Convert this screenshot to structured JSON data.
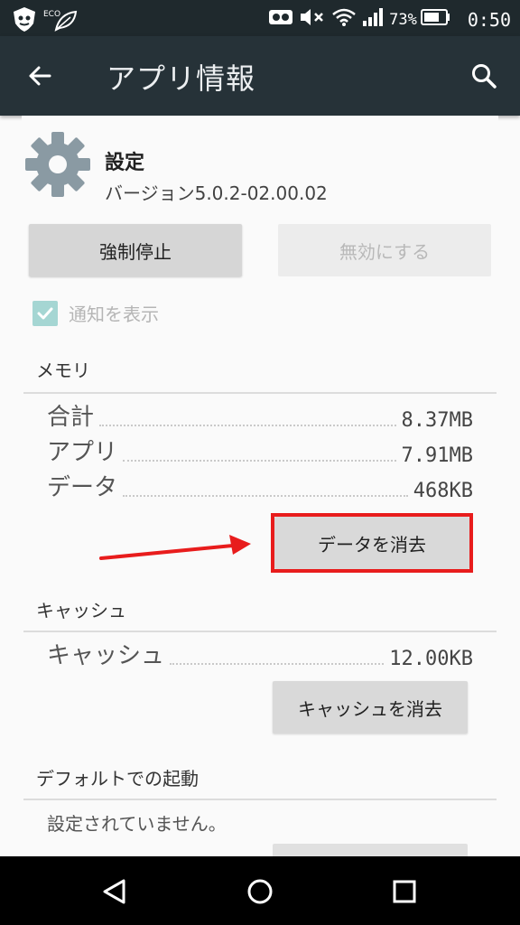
{
  "status_bar": {
    "eco_label": "ECO",
    "battery_percent": "73%",
    "time": "0:50"
  },
  "app_bar": {
    "title": "アプリ情報"
  },
  "app": {
    "name": "設定",
    "version": "バージョン5.0.2-02.00.02"
  },
  "actions": {
    "force_stop": "強制停止",
    "disable": "無効にする"
  },
  "notifications": {
    "label": "通知を表示",
    "checked": true
  },
  "memory": {
    "title": "メモリ",
    "rows": [
      {
        "label": "合計",
        "value": "8.37MB"
      },
      {
        "label": "アプリ",
        "value": "7.91MB"
      },
      {
        "label": "データ",
        "value": "468KB"
      }
    ],
    "clear_button": "データを消去"
  },
  "cache": {
    "title": "キャッシュ",
    "rows": [
      {
        "label": "キャッシュ",
        "value": "12.00KB"
      }
    ],
    "clear_button": "キャッシュを消去"
  },
  "default_launch": {
    "title": "デフォルトでの起動",
    "text": "設定されていません。"
  },
  "colors": {
    "status_bar": "#1f292d",
    "app_bar": "#263238",
    "highlight": "#e81c1c",
    "checkbox": "#a5d6d3"
  },
  "icons": {
    "back": "arrow-left-icon",
    "search": "search-icon",
    "app": "gear-icon",
    "nav_back": "triangle-back-icon",
    "nav_home": "circle-home-icon",
    "nav_recent": "square-recent-icon"
  }
}
